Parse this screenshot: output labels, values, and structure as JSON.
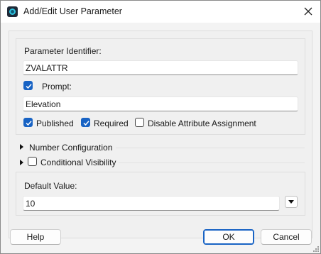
{
  "window": {
    "title": "Add/Edit User Parameter"
  },
  "fields": {
    "parameter_identifier_label": "Parameter Identifier:",
    "parameter_identifier_value": "ZVALATTR",
    "prompt_label": "Prompt:",
    "prompt_checked": true,
    "prompt_value": "Elevation",
    "published_label": "Published",
    "published_checked": true,
    "required_label": "Required",
    "required_checked": true,
    "disable_attr_label": "Disable Attribute Assignment",
    "disable_attr_checked": false
  },
  "sections": {
    "number_config_label": "Number Configuration",
    "conditional_visibility_label": "Conditional Visibility",
    "conditional_visibility_checked": false
  },
  "default": {
    "label": "Default Value:",
    "value": "10"
  },
  "buttons": {
    "help": "Help",
    "ok": "OK",
    "cancel": "Cancel"
  },
  "icons": {
    "app": "app-logo-icon",
    "close": "close-icon",
    "dropdown": "dropdown-arrow-icon",
    "expand": "expand-triangle-icon",
    "resize": "resize-grip-icon"
  },
  "colors": {
    "accent": "#1863c4",
    "window_bg": "#f3f3f3"
  }
}
